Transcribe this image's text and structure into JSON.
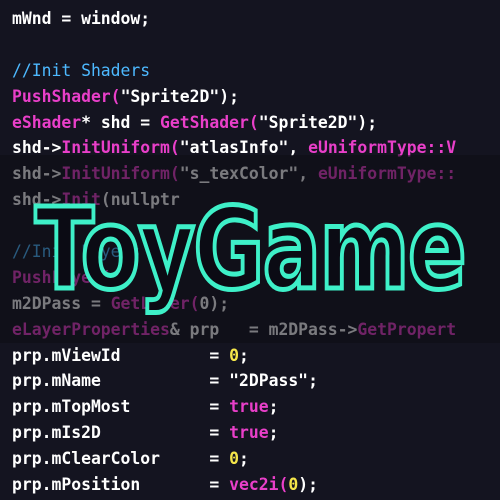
{
  "code_lines": [
    [
      {
        "t": "mWnd = window;",
        "c": "id"
      }
    ],
    [],
    [
      {
        "t": "//Init Shaders",
        "c": "cm"
      }
    ],
    [
      {
        "t": "PushShader(",
        "c": "fn"
      },
      {
        "t": "\"Sprite2D\"",
        "c": "str"
      },
      {
        "t": ");",
        "c": "id"
      }
    ],
    [
      {
        "t": "eShader",
        "c": "cls"
      },
      {
        "t": "* shd = ",
        "c": "id"
      },
      {
        "t": "GetShader(",
        "c": "fn"
      },
      {
        "t": "\"Sprite2D\"",
        "c": "str"
      },
      {
        "t": ");",
        "c": "id"
      }
    ],
    [
      {
        "t": "shd->",
        "c": "id"
      },
      {
        "t": "InitUniform(",
        "c": "fn"
      },
      {
        "t": "\"atlasInfo\"",
        "c": "str"
      },
      {
        "t": ", ",
        "c": "id"
      },
      {
        "t": "eUniformType::V",
        "c": "cls"
      }
    ],
    [
      {
        "t": "shd->",
        "c": "id"
      },
      {
        "t": "InitUniform(",
        "c": "fn"
      },
      {
        "t": "\"s_texColor\"",
        "c": "str"
      },
      {
        "t": ", ",
        "c": "id"
      },
      {
        "t": "eUniformType::",
        "c": "cls"
      }
    ],
    [
      {
        "t": "shd->",
        "c": "id"
      },
      {
        "t": "Init",
        "c": "fn"
      },
      {
        "t": "(nullptr",
        "c": "id"
      }
    ],
    [],
    [
      {
        "t": "//Init Layers",
        "c": "cm"
      }
    ],
    [
      {
        "t": "PushLayer(",
        "c": "fn"
      }
    ],
    [
      {
        "t": "m2DPass = ",
        "c": "id"
      },
      {
        "t": "GetLayer(",
        "c": "fn"
      },
      {
        "t": "0);",
        "c": "id"
      }
    ],
    [
      {
        "t": "eLayerProperties",
        "c": "cls"
      },
      {
        "t": "& prp   = m2DPass->",
        "c": "id"
      },
      {
        "t": "GetPropert",
        "c": "fn"
      }
    ],
    [
      {
        "t": "prp.mViewId         = ",
        "c": "id"
      },
      {
        "t": "0",
        "c": "nm"
      },
      {
        "t": ";",
        "c": "id"
      }
    ],
    [
      {
        "t": "prp.mName           = ",
        "c": "id"
      },
      {
        "t": "\"2DPass\"",
        "c": "str"
      },
      {
        "t": ";",
        "c": "id"
      }
    ],
    [
      {
        "t": "prp.mTopMost        = ",
        "c": "id"
      },
      {
        "t": "true",
        "c": "kw"
      },
      {
        "t": ";",
        "c": "id"
      }
    ],
    [
      {
        "t": "prp.mIs2D           = ",
        "c": "id"
      },
      {
        "t": "true",
        "c": "kw"
      },
      {
        "t": ";",
        "c": "id"
      }
    ],
    [
      {
        "t": "prp.mClearColor     = ",
        "c": "id"
      },
      {
        "t": "0",
        "c": "nm"
      },
      {
        "t": ";",
        "c": "id"
      }
    ],
    [
      {
        "t": "prp.mPosition       = ",
        "c": "id"
      },
      {
        "t": "vec2i(",
        "c": "fn"
      },
      {
        "t": "0",
        "c": "nm"
      },
      {
        "t": ");",
        "c": "id"
      }
    ]
  ],
  "logo": {
    "text": "ToyGame"
  },
  "colors": {
    "background": "#141420",
    "logo_outline": "#3ef0c8",
    "logo_fill": "#0b0b14"
  }
}
